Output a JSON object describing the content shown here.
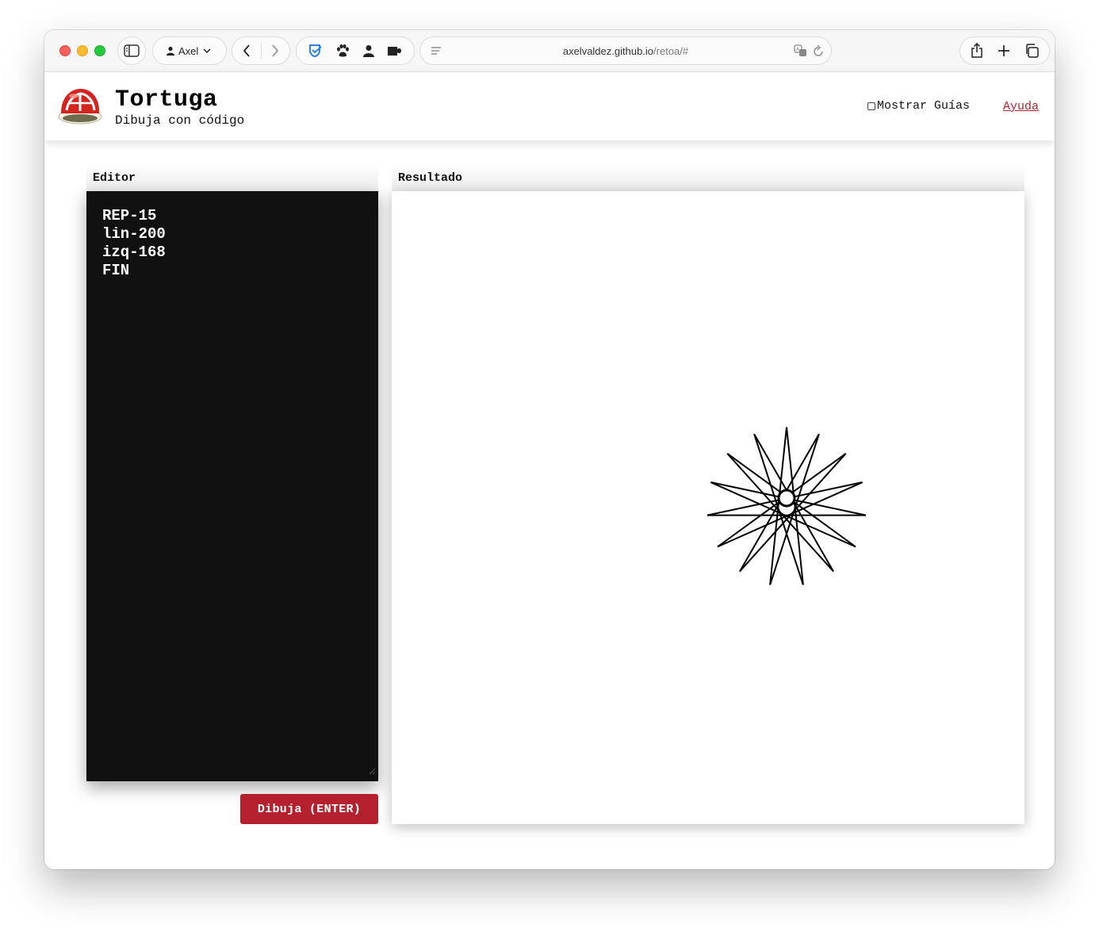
{
  "browser": {
    "profile_label": "Axel",
    "url_host": "axelvaldez.github.io",
    "url_path": "/retoa/#"
  },
  "header": {
    "title": "Tortuga",
    "subtitle": "Dibuja con código",
    "show_guides_label": "Mostrar Guías",
    "show_guides_checked": false,
    "help_link": "Ayuda"
  },
  "editor": {
    "heading": "Editor",
    "lines": [
      "REP-15",
      "lin-200",
      "izq-168",
      "FIN"
    ]
  },
  "draw_button": {
    "label": "Dibuja (ENTER)"
  },
  "result": {
    "heading": "Resultado",
    "program": {
      "repeat": 15,
      "forward": 200,
      "turn_left_deg": 168
    }
  },
  "colors": {
    "accent": "#b5202e",
    "editor_bg": "#111111",
    "editor_text": "#ffffff",
    "stroke": "#000000"
  }
}
